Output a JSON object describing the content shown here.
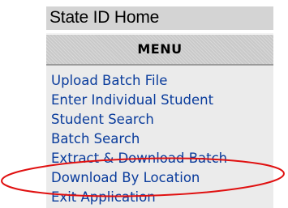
{
  "header": {
    "title": "State ID Home"
  },
  "menu": {
    "heading": "MENU",
    "items": [
      {
        "label": "Upload Batch File"
      },
      {
        "label": "Enter Individual Student"
      },
      {
        "label": "Student Search"
      },
      {
        "label": "Batch Search"
      },
      {
        "label": "Extract & Download Batch"
      },
      {
        "label": "Download By Location"
      },
      {
        "label": "Exit Application"
      }
    ]
  },
  "annotation": {
    "color": "#e01010",
    "highlighted_item": "Download By Location"
  }
}
